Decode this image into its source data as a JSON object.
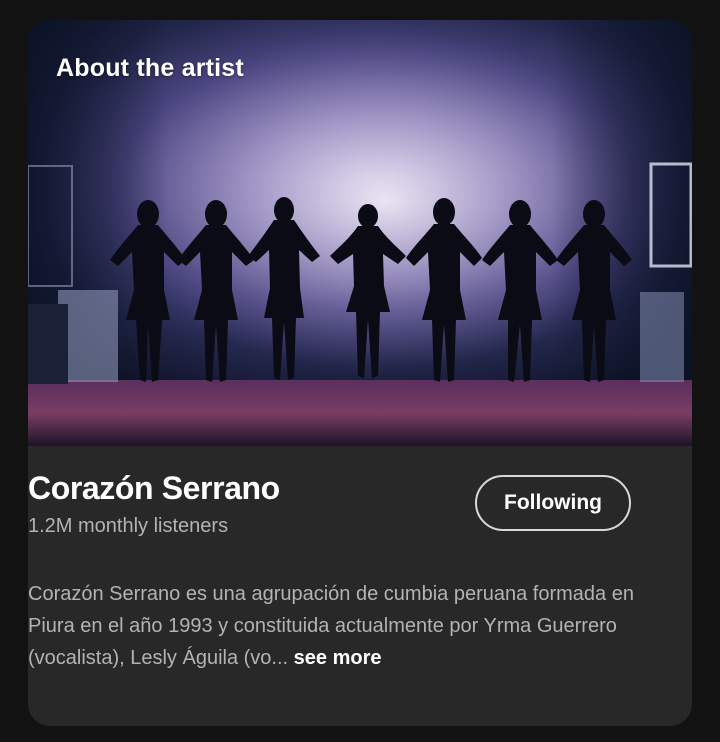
{
  "section": {
    "title": "About the artist"
  },
  "artist": {
    "name": "Corazón Serrano",
    "monthly_listeners": "1.2M monthly listeners",
    "follow_label": "Following",
    "bio": "Corazón Serrano es una agrupación de cumbia peruana formada en Piura en el año 1993 y constituida actualmente por Yrma Guerrero (vocalista), Lesly Águila (vo...",
    "see_more_label": "see more"
  },
  "colors": {
    "page_background": "#121212",
    "card_background": "#282828",
    "secondary_text": "#b3b3b3",
    "button_border": "#d9d9d9"
  }
}
